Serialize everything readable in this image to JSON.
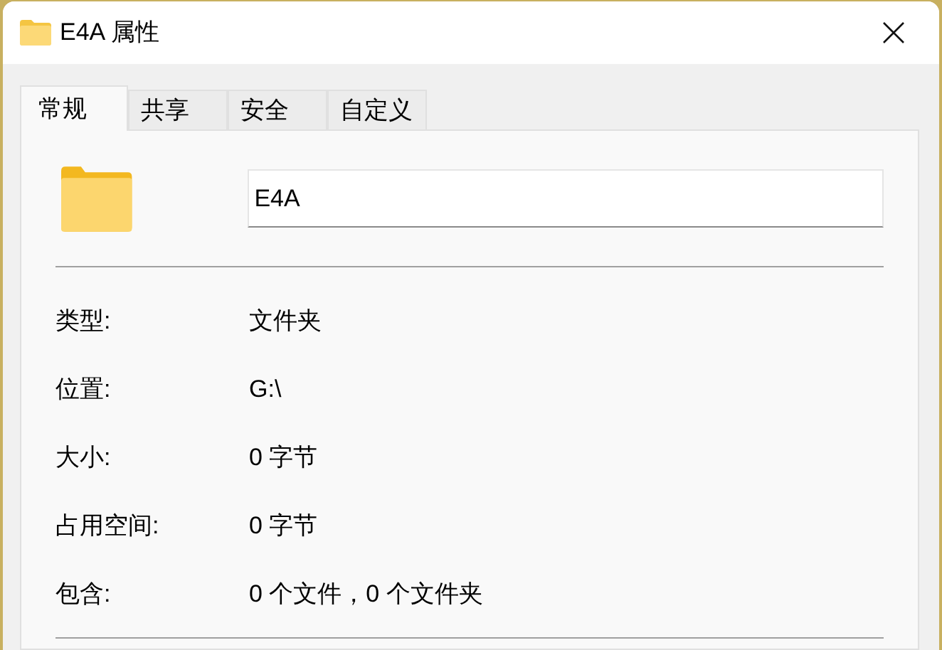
{
  "window": {
    "title": "E4A 属性"
  },
  "tabs": [
    {
      "label": "常规",
      "selected": true
    },
    {
      "label": "共享",
      "selected": false
    },
    {
      "label": "安全",
      "selected": false
    },
    {
      "label": "自定义",
      "selected": false
    }
  ],
  "name_field": {
    "value": "E4A"
  },
  "properties": [
    {
      "label": "类型:",
      "value": "文件夹"
    },
    {
      "label": "位置:",
      "value": "G:\\"
    },
    {
      "label": "大小:",
      "value": "0 字节"
    },
    {
      "label": "占用空间:",
      "value": "0 字节"
    },
    {
      "label": "包含:",
      "value": "0 个文件，0 个文件夹"
    }
  ]
}
